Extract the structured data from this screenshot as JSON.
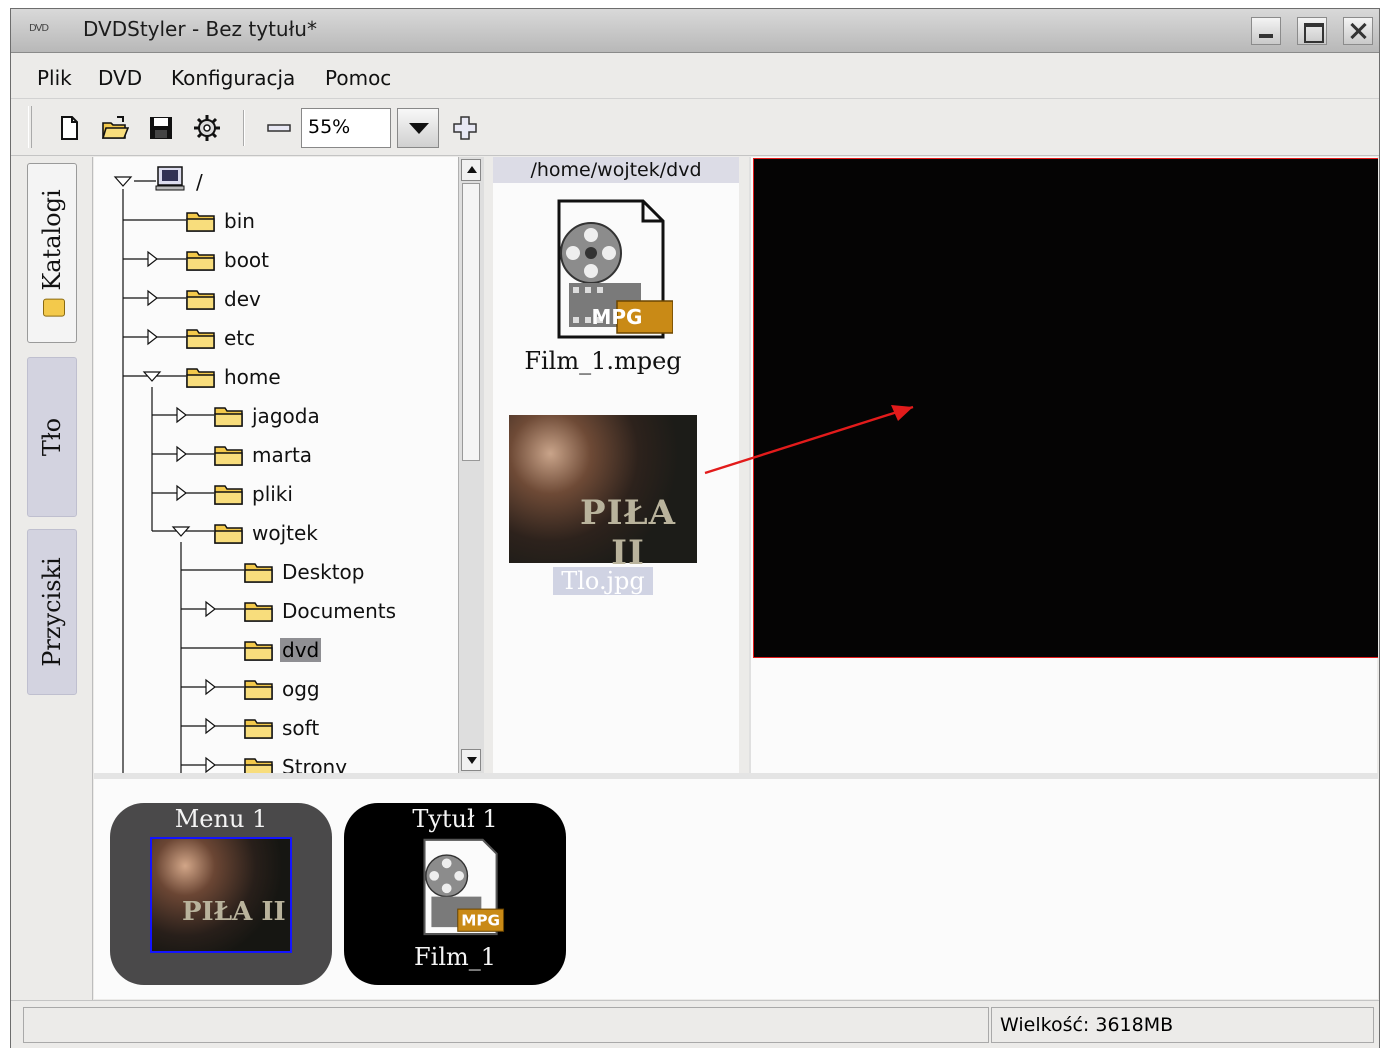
{
  "window": {
    "title": "DVDStyler - Bez tytułu*",
    "app_icon_text": "DVD"
  },
  "menubar": [
    {
      "label": "Plik"
    },
    {
      "label": "DVD"
    },
    {
      "label": "Konfiguracja"
    },
    {
      "label": "Pomoc"
    }
  ],
  "toolbar": {
    "zoom_value": "55%",
    "icons": [
      "new-file-icon",
      "open-folder-icon",
      "save-icon",
      "settings-gear-icon",
      "zoom-out-icon",
      "zoom-in-icon"
    ]
  },
  "side_tabs": [
    {
      "label": "Katalogi",
      "active": true
    },
    {
      "label": "Tło",
      "active": false
    },
    {
      "label": "Przyciski",
      "active": false
    }
  ],
  "tree": {
    "root": "/",
    "items": [
      {
        "label": "bin",
        "depth": 1,
        "expander": "none"
      },
      {
        "label": "boot",
        "depth": 1,
        "expander": "collapsed"
      },
      {
        "label": "dev",
        "depth": 1,
        "expander": "collapsed"
      },
      {
        "label": "etc",
        "depth": 1,
        "expander": "collapsed"
      },
      {
        "label": "home",
        "depth": 1,
        "expander": "expanded"
      },
      {
        "label": "jagoda",
        "depth": 2,
        "expander": "collapsed"
      },
      {
        "label": "marta",
        "depth": 2,
        "expander": "collapsed"
      },
      {
        "label": "pliki",
        "depth": 2,
        "expander": "collapsed"
      },
      {
        "label": "wojtek",
        "depth": 2,
        "expander": "expanded"
      },
      {
        "label": "Desktop",
        "depth": 3,
        "expander": "none"
      },
      {
        "label": "Documents",
        "depth": 3,
        "expander": "collapsed"
      },
      {
        "label": "dvd",
        "depth": 3,
        "expander": "none",
        "selected": true
      },
      {
        "label": "ogg",
        "depth": 3,
        "expander": "collapsed"
      },
      {
        "label": "soft",
        "depth": 3,
        "expander": "collapsed"
      },
      {
        "label": "Strony",
        "depth": 3,
        "expander": "collapsed"
      }
    ]
  },
  "files": {
    "path": "/home/wojtek/dvd",
    "items": [
      {
        "name": "Film_1.mpeg",
        "type": "mpg"
      },
      {
        "name": "Tlo.jpg",
        "type": "image",
        "selected": true,
        "image_text": "PIŁA II"
      }
    ]
  },
  "titleset": [
    {
      "name": "Menu 1",
      "kind": "menu",
      "image_text": "PIŁA II"
    },
    {
      "name": "Tytuł 1",
      "kind": "title",
      "file_label": "Film_1",
      "badge": "MPG"
    }
  ],
  "mpg_badge": "MPG",
  "status": {
    "left": "",
    "right": "Wielkość: 3618MB"
  },
  "colors": {
    "canvas": "#050404",
    "canvas_border": "#e21b1b",
    "arrow": "#e21b1b",
    "folder": "#f3c94b",
    "tab_inactive": "#d3d3e0"
  }
}
